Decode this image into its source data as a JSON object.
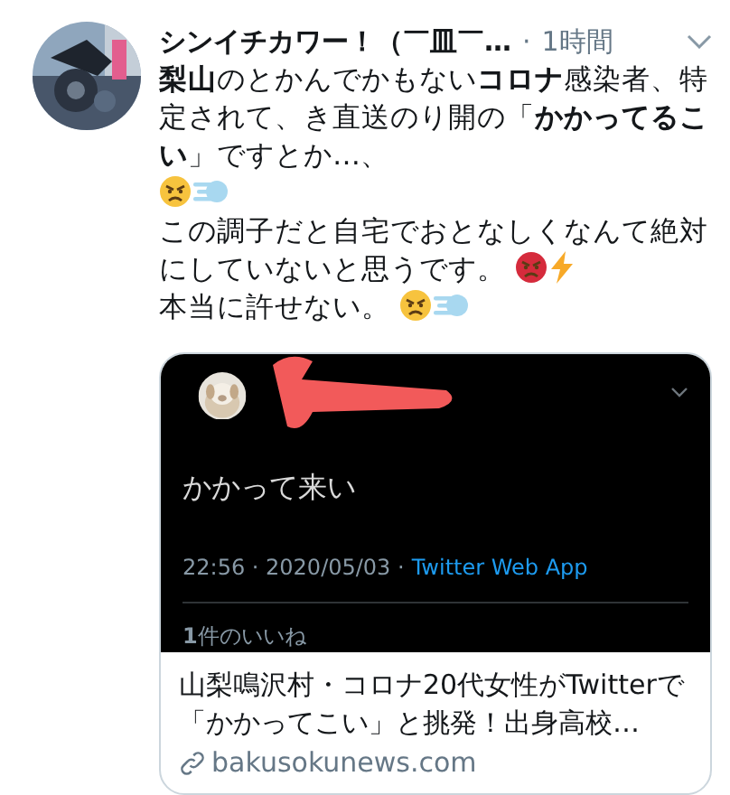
{
  "tweet": {
    "author": "シンイチカワー！（￣皿￣…",
    "separator": "·",
    "time": "1時間",
    "body": [
      {
        "text": "**梨山**のとかんでかもない**コロナ**感染者、特定されて、き直送のり開の「**かかってるこい**」ですとか…、"
      },
      {
        "emoji": [
          {
            "kind": "angry"
          },
          {
            "kind": "dash"
          }
        ]
      },
      {
        "text": "この調子だと自宅でおとなしくなんて絶対"
      },
      {
        "text": "にしていないと思うです。",
        "emoji": [
          {
            "kind": "pouting"
          },
          {
            "kind": "zap"
          }
        ]
      },
      {
        "text": "本当に許せない。",
        "emoji": [
          {
            "kind": "angry"
          },
          {
            "kind": "dash"
          }
        ]
      }
    ],
    "quoted": {
      "text": "かかって来い",
      "timestamp": "22:56 · 2020/05/03 ·",
      "source": "Twitter Web App",
      "likes": "**1**件のいいね"
    },
    "link_card": {
      "title": "山梨鳴沢村・コロナ20代女性がTwitterで「かかってこい」と挑発！出身高校…",
      "domain": "bakusokunews.com"
    }
  }
}
